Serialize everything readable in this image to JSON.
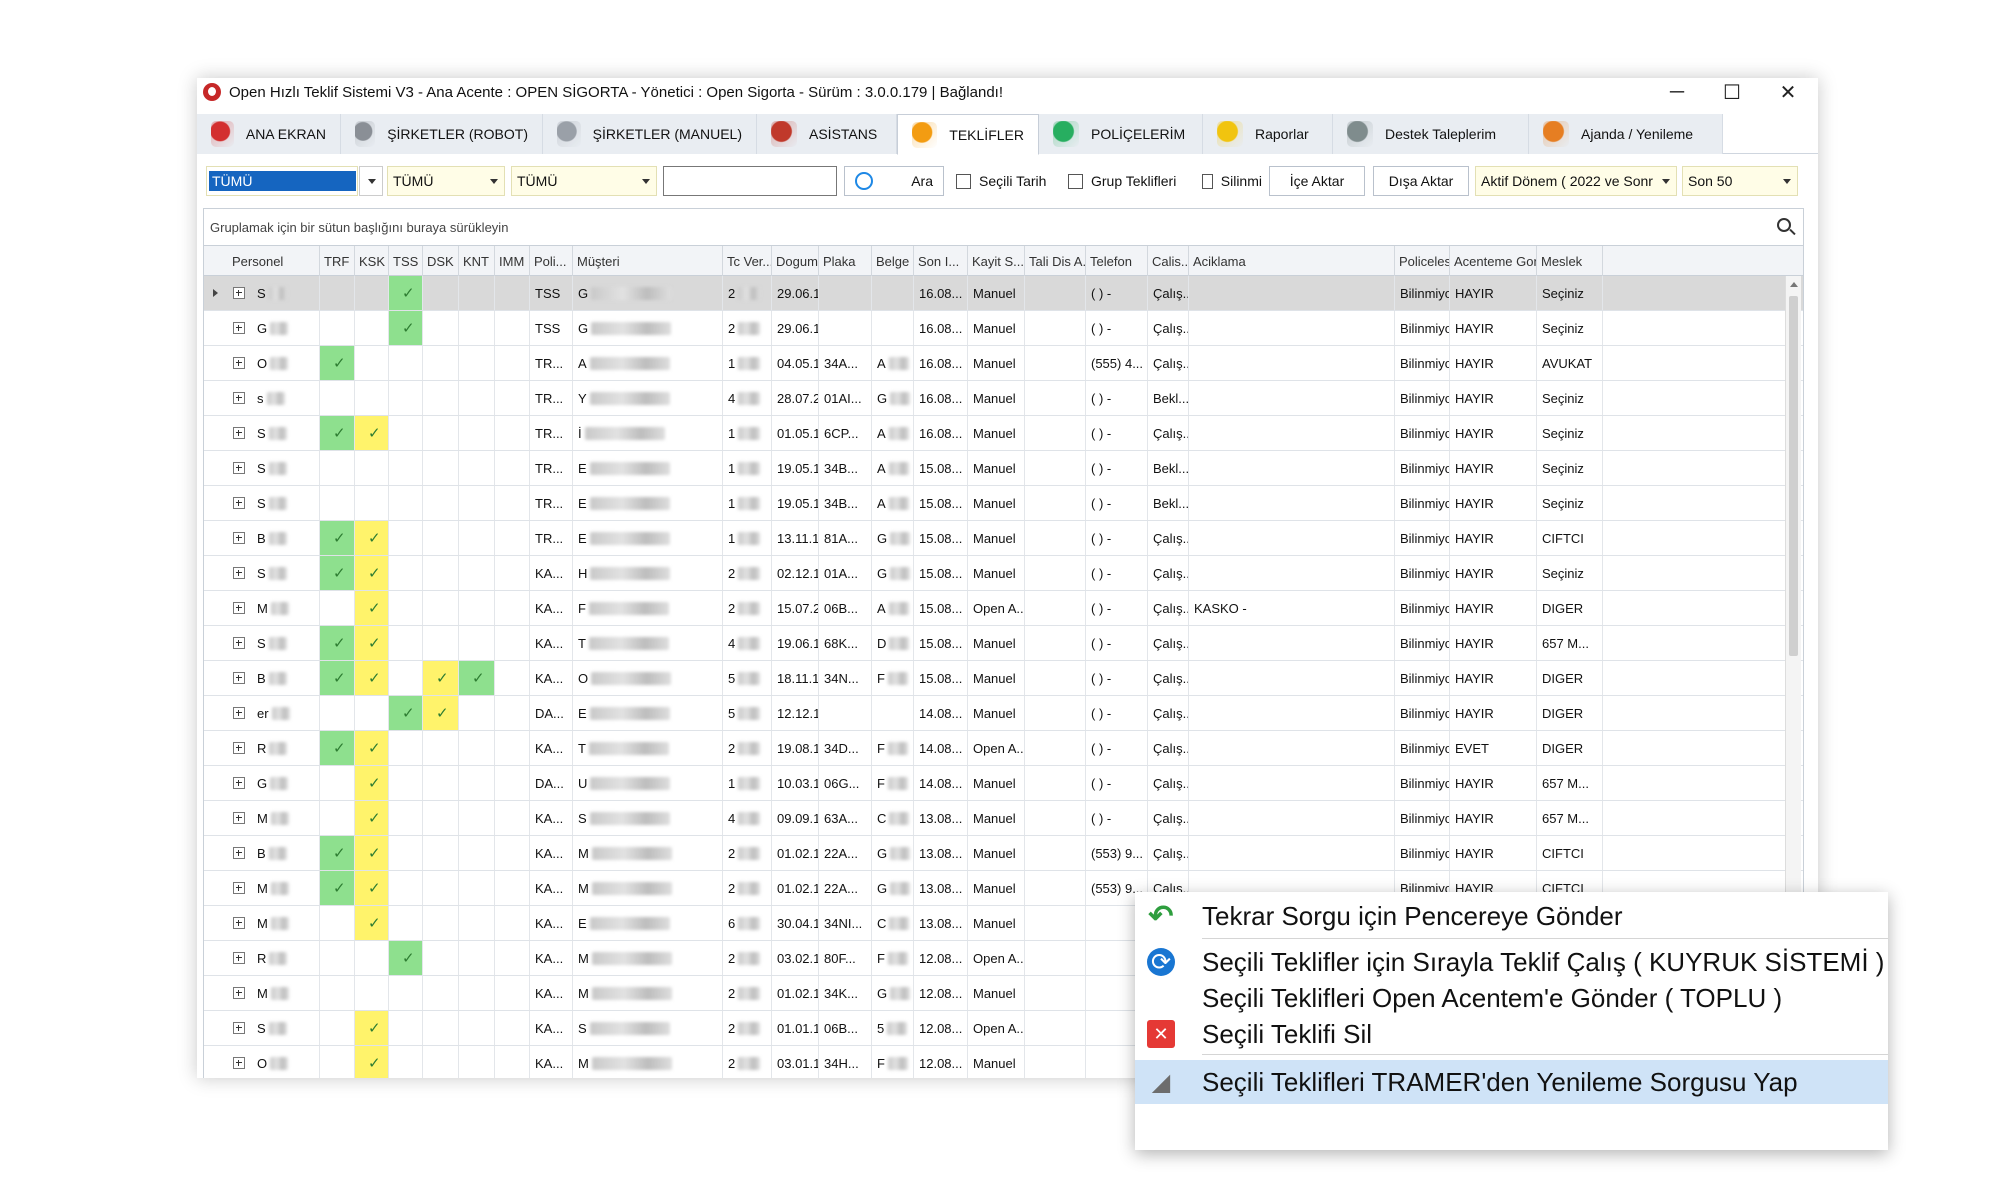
{
  "window": {
    "title": "Open Hızlı Teklif Sistemi V3 - Ana Acente : OPEN SİGORTA - Yönetici : Open Sigorta - Sürüm : 3.0.0.179 | Bağlandı!",
    "controls": {
      "minimize": "─",
      "maximize": "☐",
      "close": "✕"
    }
  },
  "tabs": [
    {
      "label": "ANA EKRAN",
      "icon": "alert-icon",
      "color": "#d32f2f"
    },
    {
      "label": "ŞİRKETLER (ROBOT)",
      "icon": "gear-icon",
      "color": "#8a8f96"
    },
    {
      "label": "ŞİRKETLER (MANUEL)",
      "icon": "gears-icon",
      "color": "#9aa0a8"
    },
    {
      "label": "ASİSTANS",
      "icon": "tow-truck-icon",
      "color": "#c0392b"
    },
    {
      "label": "TEKLİFLER",
      "icon": "documents-icon",
      "color": "#f39c12"
    },
    {
      "label": "POLİÇELERİM",
      "icon": "policy-icon",
      "color": "#27ae60"
    },
    {
      "label": "Raporlar",
      "icon": "report-icon",
      "color": "#f1c40f"
    },
    {
      "label": "Destek Taleplerim",
      "icon": "support-icon",
      "color": "#7f8c8d"
    },
    {
      "label": "Ajanda / Yenileme",
      "icon": "calendar-icon",
      "color": "#e67e22"
    }
  ],
  "filters": {
    "dd1": "TÜMÜ",
    "dd2": "TÜMÜ",
    "dd3": "TÜMÜ",
    "search_value": "",
    "search_button": "Ara",
    "cb_secili_tarih": "Seçili Tarih",
    "cb_grup": "Grup Teklifleri",
    "cb_silinmis": "Silinmi",
    "ice_aktar": "İçe Aktar",
    "disa_aktar": "Dışa Aktar",
    "donem": "Aktif Dönem ( 2022 ve Sonr",
    "son": "Son  50"
  },
  "groupbar": "Gruplamak için bir sütun başlığını buraya sürükleyin",
  "columns": [
    "Personel",
    "TRF",
    "KSK",
    "TSS",
    "DSK",
    "KNT",
    "IMM",
    "Poli...",
    "Müşteri",
    "Tc Ver...",
    "Dogum ...",
    "Plaka",
    "Belge ...",
    "Son I...",
    "Kayit S...",
    "Tali Dis A...",
    "Telefon",
    "Calis...",
    "Aciklama",
    "Policeles...",
    "Acenteme Gon...",
    "Meslek"
  ],
  "rows": [
    {
      "p": "S",
      "trf": "",
      "ksk": "",
      "tss": "g",
      "dsk": "",
      "knt": "",
      "poli": "TSS",
      "m": "G",
      "tc": "2",
      "dog": "29.06.1...",
      "plaka": "",
      "belge": "",
      "son": "16.08...",
      "kayit": "Manuel",
      "tel": "(  )  -",
      "calis": "Çalış...",
      "acik": "",
      "pol": "Bilinmiyor",
      "ac": "HAYIR",
      "meslek": "Seçiniz"
    },
    {
      "p": "G",
      "trf": "",
      "ksk": "",
      "tss": "g",
      "dsk": "",
      "knt": "",
      "poli": "TSS",
      "m": "G",
      "tc": "2",
      "dog": "29.06.1...",
      "plaka": "",
      "belge": "",
      "son": "16.08...",
      "kayit": "Manuel",
      "tel": "(  )  -",
      "calis": "Çalış...",
      "acik": "",
      "pol": "Bilinmiyor",
      "ac": "HAYIR",
      "meslek": "Seçiniz"
    },
    {
      "p": "O",
      "trf": "g",
      "ksk": "",
      "tss": "",
      "dsk": "",
      "knt": "",
      "poli": "TR...",
      "m": "A",
      "tc": "1",
      "dog": "04.05.1...",
      "plaka": "34A...",
      "belge": "A",
      "son": "16.08...",
      "kayit": "Manuel",
      "tel": "(555) 4...",
      "calis": "Çalış...",
      "acik": "",
      "pol": "Bilinmiyor",
      "ac": "HAYIR",
      "meslek": "AVUKAT"
    },
    {
      "p": "s",
      "trf": "",
      "ksk": "",
      "tss": "",
      "dsk": "",
      "knt": "",
      "poli": "TR...",
      "m": "Y",
      "tc": "4",
      "dog": "28.07.2...",
      "plaka": "01AI...",
      "belge": "G",
      "son": "16.08...",
      "kayit": "Manuel",
      "tel": "(  )  -",
      "calis": "Bekl...",
      "acik": "",
      "pol": "Bilinmiyor",
      "ac": "HAYIR",
      "meslek": "Seçiniz"
    },
    {
      "p": "S",
      "trf": "g",
      "ksk": "y",
      "tss": "",
      "dsk": "",
      "knt": "",
      "poli": "TR...",
      "m": "İ",
      "tc": "1",
      "dog": "01.05.1...",
      "plaka": "6CP...",
      "belge": "A",
      "son": "16.08...",
      "kayit": "Manuel",
      "tel": "(  )  -",
      "calis": "Çalış...",
      "acik": "",
      "pol": "Bilinmiyor",
      "ac": "HAYIR",
      "meslek": "Seçiniz"
    },
    {
      "p": "S",
      "trf": "",
      "ksk": "",
      "tss": "",
      "dsk": "",
      "knt": "",
      "poli": "TR...",
      "m": "E",
      "tc": "1",
      "dog": "19.05.1...",
      "plaka": "34B...",
      "belge": "A",
      "son": "15.08...",
      "kayit": "Manuel",
      "tel": "(  )  -",
      "calis": "Bekl...",
      "acik": "",
      "pol": "Bilinmiyor",
      "ac": "HAYIR",
      "meslek": "Seçiniz"
    },
    {
      "p": "S",
      "trf": "",
      "ksk": "",
      "tss": "",
      "dsk": "",
      "knt": "",
      "poli": "TR...",
      "m": "E",
      "tc": "1",
      "dog": "19.05.1...",
      "plaka": "34B...",
      "belge": "A",
      "son": "15.08...",
      "kayit": "Manuel",
      "tel": "(  )  -",
      "calis": "Bekl...",
      "acik": "",
      "pol": "Bilinmiyor",
      "ac": "HAYIR",
      "meslek": "Seçiniz"
    },
    {
      "p": "B",
      "trf": "g",
      "ksk": "y",
      "tss": "",
      "dsk": "",
      "knt": "",
      "poli": "TR...",
      "m": "E",
      "tc": "1",
      "dog": "13.11.1...",
      "plaka": "81A...",
      "belge": "G",
      "son": "15.08...",
      "kayit": "Manuel",
      "tel": "(  )  -",
      "calis": "Çalış...",
      "acik": "",
      "pol": "Bilinmiyor",
      "ac": "HAYIR",
      "meslek": "CIFTCI"
    },
    {
      "p": "S",
      "trf": "g",
      "ksk": "y",
      "tss": "",
      "dsk": "",
      "knt": "",
      "poli": "KA...",
      "m": "H",
      "tc": "2",
      "dog": "02.12.1...",
      "plaka": "01A...",
      "belge": "G",
      "son": "15.08...",
      "kayit": "Manuel",
      "tel": "(  )  -",
      "calis": "Çalış...",
      "acik": "",
      "pol": "Bilinmiyor",
      "ac": "HAYIR",
      "meslek": "Seçiniz"
    },
    {
      "p": "M",
      "trf": "",
      "ksk": "y",
      "tss": "",
      "dsk": "",
      "knt": "",
      "poli": "KA...",
      "m": "F",
      "tc": "2",
      "dog": "15.07.2...",
      "plaka": "06B...",
      "belge": "A",
      "son": "15.08...",
      "kayit": "Open A...",
      "tel": "(  )  -",
      "calis": "Çalış...",
      "acik": "KASKO -",
      "pol": "Bilinmiyor",
      "ac": "HAYIR",
      "meslek": "DIGER"
    },
    {
      "p": "S",
      "trf": "g",
      "ksk": "y",
      "tss": "",
      "dsk": "",
      "knt": "",
      "poli": "KA...",
      "m": "T",
      "tc": "4",
      "dog": "19.06.1...",
      "plaka": "68K...",
      "belge": "D",
      "son": "15.08...",
      "kayit": "Manuel",
      "tel": "(  )  -",
      "calis": "Çalış...",
      "acik": "",
      "pol": "Bilinmiyor",
      "ac": "HAYIR",
      "meslek": "657 M..."
    },
    {
      "p": "B",
      "trf": "g",
      "ksk": "y",
      "tss": "",
      "dsk": "y",
      "knt": "g",
      "poli": "KA...",
      "m": "O",
      "tc": "5",
      "dog": "18.11.1...",
      "plaka": "34N...",
      "belge": "F",
      "son": "15.08...",
      "kayit": "Manuel",
      "tel": "(  )  -",
      "calis": "Çalış...",
      "acik": "",
      "pol": "Bilinmiyor",
      "ac": "HAYIR",
      "meslek": "DIGER"
    },
    {
      "p": "er",
      "trf": "",
      "ksk": "",
      "tss": "g",
      "dsk": "y",
      "knt": "",
      "poli": "DA...",
      "m": "E",
      "tc": "5",
      "dog": "12.12.1...",
      "plaka": "",
      "belge": "",
      "son": "14.08...",
      "kayit": "Manuel",
      "tel": "(  )  -",
      "calis": "Çalış...",
      "acik": "",
      "pol": "Bilinmiyor",
      "ac": "HAYIR",
      "meslek": "DIGER"
    },
    {
      "p": "R",
      "trf": "g",
      "ksk": "y",
      "tss": "",
      "dsk": "",
      "knt": "",
      "poli": "KA...",
      "m": "T",
      "tc": "2",
      "dog": "19.08.1...",
      "plaka": "34D...",
      "belge": "F",
      "son": "14.08...",
      "kayit": "Open A...",
      "tel": "(  )  -",
      "calis": "Çalış...",
      "acik": "",
      "pol": "Bilinmiyor",
      "ac": "EVET",
      "meslek": "DIGER"
    },
    {
      "p": "G",
      "trf": "",
      "ksk": "y",
      "tss": "",
      "dsk": "",
      "knt": "",
      "poli": "DA...",
      "m": "U",
      "tc": "1",
      "dog": "10.03.1...",
      "plaka": "06G...",
      "belge": "F",
      "son": "14.08...",
      "kayit": "Manuel",
      "tel": "(  )  -",
      "calis": "Çalış...",
      "acik": "",
      "pol": "Bilinmiyor",
      "ac": "HAYIR",
      "meslek": "657 M..."
    },
    {
      "p": "M",
      "trf": "",
      "ksk": "y",
      "tss": "",
      "dsk": "",
      "knt": "",
      "poli": "KA...",
      "m": "S",
      "tc": "4",
      "dog": "09.09.1...",
      "plaka": "63A...",
      "belge": "C",
      "son": "13.08...",
      "kayit": "Manuel",
      "tel": "(  )  -",
      "calis": "Çalış...",
      "acik": "",
      "pol": "Bilinmiyor",
      "ac": "HAYIR",
      "meslek": "657 M..."
    },
    {
      "p": "B",
      "trf": "g",
      "ksk": "y",
      "tss": "",
      "dsk": "",
      "knt": "",
      "poli": "KA...",
      "m": "M",
      "tc": "2",
      "dog": "01.02.1...",
      "plaka": "22A...",
      "belge": "G",
      "son": "13.08...",
      "kayit": "Manuel",
      "tel": "(553) 9...",
      "calis": "Çalış...",
      "acik": "",
      "pol": "Bilinmiyor",
      "ac": "HAYIR",
      "meslek": "CIFTCI"
    },
    {
      "p": "M",
      "trf": "g",
      "ksk": "y",
      "tss": "",
      "dsk": "",
      "knt": "",
      "poli": "KA...",
      "m": "M",
      "tc": "2",
      "dog": "01.02.1...",
      "plaka": "22A...",
      "belge": "G",
      "son": "13.08...",
      "kayit": "Manuel",
      "tel": "(553) 9...",
      "calis": "Çalış...",
      "acik": "",
      "pol": "Bilinmiyor",
      "ac": "HAYIR",
      "meslek": "CIFTCI"
    },
    {
      "p": "M",
      "trf": "",
      "ksk": "y",
      "tss": "",
      "dsk": "",
      "knt": "",
      "poli": "KA...",
      "m": "E",
      "tc": "6",
      "dog": "30.04.1...",
      "plaka": "34NI...",
      "belge": "C",
      "son": "13.08...",
      "kayit": "Manuel",
      "tel": "",
      "calis": "",
      "acik": "",
      "pol": "",
      "ac": "",
      "meslek": ""
    },
    {
      "p": "R",
      "trf": "",
      "ksk": "",
      "tss": "g",
      "dsk": "",
      "knt": "",
      "poli": "KA...",
      "m": "M",
      "tc": "2",
      "dog": "03.02.1...",
      "plaka": "80F...",
      "belge": "F",
      "son": "12.08...",
      "kayit": "Open A...",
      "tel": "",
      "calis": "",
      "acik": "",
      "pol": "",
      "ac": "",
      "meslek": ""
    },
    {
      "p": "M",
      "trf": "",
      "ksk": "",
      "tss": "",
      "dsk": "",
      "knt": "",
      "poli": "KA...",
      "m": "M",
      "tc": "2",
      "dog": "01.02.1...",
      "plaka": "34K...",
      "belge": "G",
      "son": "12.08...",
      "kayit": "Manuel",
      "tel": "",
      "calis": "",
      "acik": "",
      "pol": "",
      "ac": "",
      "meslek": ""
    },
    {
      "p": "S",
      "trf": "",
      "ksk": "y",
      "tss": "",
      "dsk": "",
      "knt": "",
      "poli": "KA...",
      "m": "S",
      "tc": "2",
      "dog": "01.01.1...",
      "plaka": "06B...",
      "belge": "5",
      "son": "12.08...",
      "kayit": "Open A...",
      "tel": "",
      "calis": "",
      "acik": "",
      "pol": "",
      "ac": "",
      "meslek": ""
    },
    {
      "p": "O",
      "trf": "",
      "ksk": "y",
      "tss": "",
      "dsk": "",
      "knt": "",
      "poli": "KA...",
      "m": "M",
      "tc": "2",
      "dog": "03.01.1...",
      "plaka": "34H...",
      "belge": "F",
      "son": "12.08...",
      "kayit": "Manuel",
      "tel": "",
      "calis": "",
      "acik": "",
      "pol": "",
      "ac": "",
      "meslek": ""
    }
  ],
  "context_menu": [
    {
      "label": "Tekrar Sorgu için Pencereye Gönder",
      "icon": "undo-arrow-icon",
      "color": "#2e9e3e"
    },
    {
      "label": "Seçili Teklifler için Sırayla Teklif Çalış ( KUYRUK SİSTEMİ )",
      "icon": "refresh-circle-icon",
      "color": "#1976d2"
    },
    {
      "label": "Seçili Teklifleri Open Acentem'e Gönder ( TOPLU )",
      "icon": "",
      "color": ""
    },
    {
      "label": "Seçili Teklifi Sil",
      "icon": "delete-x-icon",
      "color": "#e53935"
    },
    {
      "label": "Seçili Teklifleri TRAMER'den Yenileme Sorgusu Yap",
      "icon": "ruler-icon",
      "color": "#6d6d6d"
    }
  ]
}
